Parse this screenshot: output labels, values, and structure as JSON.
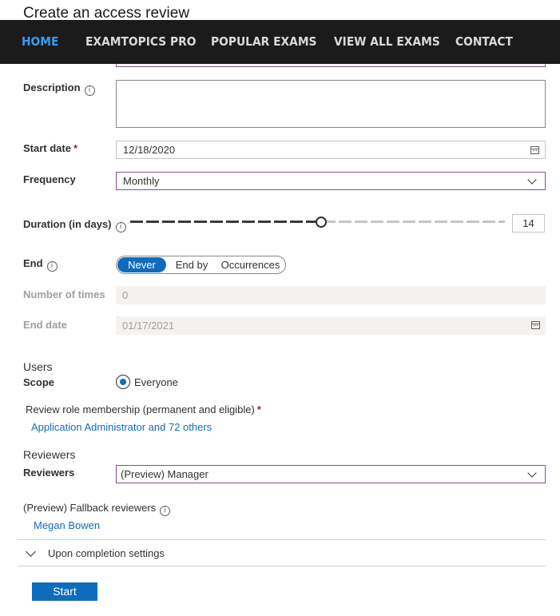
{
  "page": {
    "title": "Create an access review"
  },
  "nav": {
    "items": [
      {
        "label": "HOME",
        "active": true
      },
      {
        "label": "EXAMTOPICS PRO",
        "active": false
      },
      {
        "label": "POPULAR EXAMS",
        "active": false
      },
      {
        "label": "VIEW ALL EXAMS",
        "active": false
      },
      {
        "label": "CONTACT",
        "active": false
      }
    ]
  },
  "form": {
    "description": {
      "label": "Description",
      "info_icon": "i",
      "value": ""
    },
    "start_date": {
      "label": "Start date",
      "required_mark": "*",
      "value": "12/18/2020"
    },
    "frequency": {
      "label": "Frequency",
      "value": "Monthly"
    },
    "duration": {
      "label": "Duration (in days)",
      "info_icon": "i",
      "value": "14",
      "slider_fraction": 0.52
    },
    "end": {
      "label": "End",
      "info_icon": "i",
      "options": [
        "Never",
        "End by",
        "Occurrences"
      ],
      "selected": "Never"
    },
    "number_of_times": {
      "label": "Number of times",
      "value": "0"
    },
    "end_date": {
      "label": "End date",
      "value": "01/17/2021"
    }
  },
  "users": {
    "section_title": "Users",
    "scope_label": "Scope",
    "scope_value": "Everyone",
    "membership_label": "Review role membership (permanent and eligible)",
    "membership_required": "*",
    "membership_link": "Application Administrator and 72 others"
  },
  "reviewers": {
    "section_title": "Reviewers",
    "label": "Reviewers",
    "value": "(Preview) Manager",
    "fallback_label": "(Preview) Fallback reviewers",
    "fallback_info_icon": "i",
    "fallback_link": "Megan Bowen"
  },
  "completion": {
    "label": "Upon completion settings"
  },
  "actions": {
    "start_label": "Start"
  },
  "colors": {
    "accent": "#0f6cbd",
    "nav_bg": "#1b1b1b",
    "nav_active": "#3a9bf0",
    "focus_border": "#8a4d9c"
  }
}
